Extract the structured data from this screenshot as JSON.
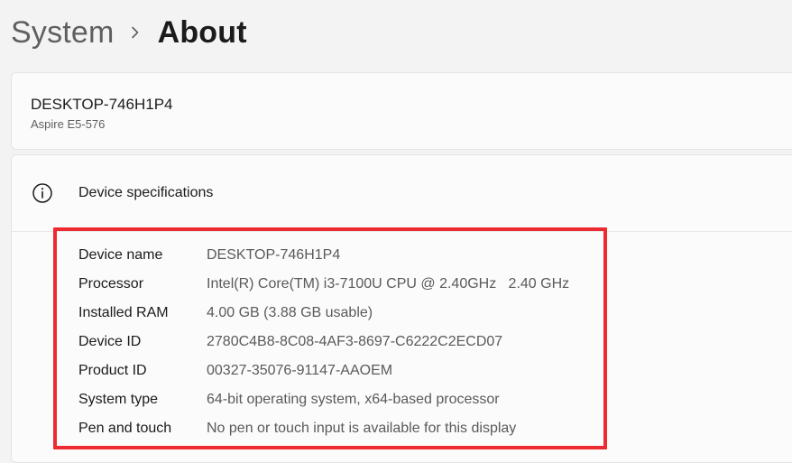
{
  "breadcrumb": {
    "parent": "System",
    "current": "About"
  },
  "device": {
    "name": "DESKTOP-746H1P4",
    "model": "Aspire E5-576"
  },
  "specs": {
    "title": "Device specifications",
    "rows": [
      {
        "label": "Device name",
        "value": "DESKTOP-746H1P4"
      },
      {
        "label": "Processor",
        "value": "Intel(R) Core(TM) i3-7100U CPU @ 2.40GHz   2.40 GHz"
      },
      {
        "label": "Installed RAM",
        "value": "4.00 GB (3.88 GB usable)"
      },
      {
        "label": "Device ID",
        "value": "2780C4B8-8C08-4AF3-8697-C6222C2ECD07"
      },
      {
        "label": "Product ID",
        "value": "00327-35076-91147-AAOEM"
      },
      {
        "label": "System type",
        "value": "64-bit operating system, x64-based processor"
      },
      {
        "label": "Pen and touch",
        "value": "No pen or touch input is available for this display"
      }
    ]
  },
  "icons": {
    "breadcrumb_separator": "chevron-right-icon",
    "spec_header": "info-icon"
  },
  "colors": {
    "background": "#f3f3f3",
    "card": "#fbfbfb",
    "highlight": "#ec2a2f"
  }
}
